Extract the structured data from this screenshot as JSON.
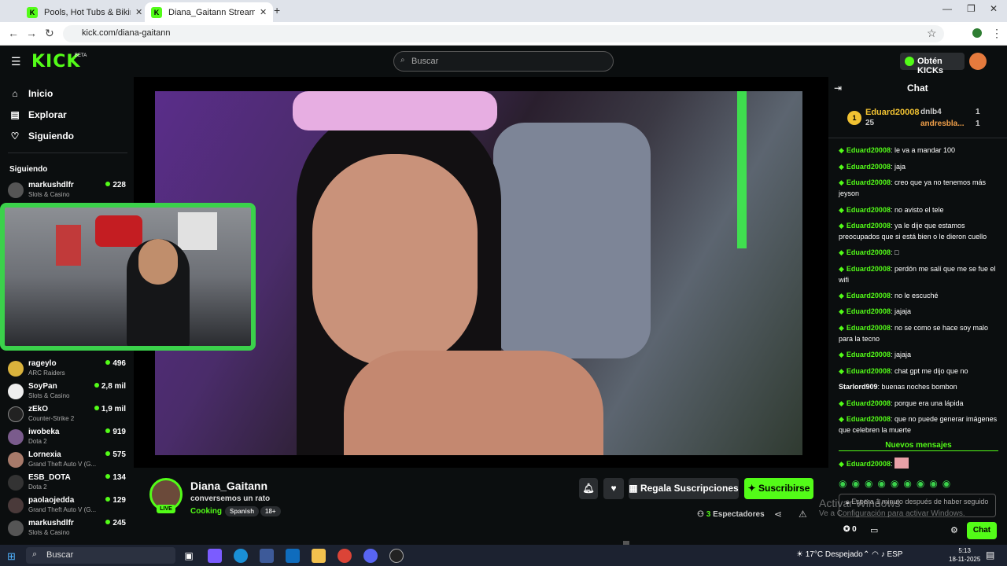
{
  "browser": {
    "tabs": [
      {
        "title": "Pools, Hot Tubs & Bikinis Strea"
      },
      {
        "title": "Diana_Gaitann Stream - Wa"
      }
    ],
    "url": "kick.com/diana-gaitann"
  },
  "header": {
    "logo": "KICK",
    "beta": "BETA",
    "search_placeholder": "Buscar",
    "kicks_label": "Obtén KICKs"
  },
  "sidebar": {
    "nav": [
      {
        "label": "Inicio"
      },
      {
        "label": "Explorar"
      },
      {
        "label": "Siguiendo"
      }
    ],
    "following_title": "Siguiendo",
    "channels": [
      {
        "name": "markushdlfr",
        "category": "Slots & Casino",
        "viewers": "228"
      },
      {
        "name": "rageylo",
        "category": "ARC Raiders",
        "viewers": "496"
      },
      {
        "name": "SoyPan",
        "category": "Slots & Casino",
        "viewers": "2,8 mil"
      },
      {
        "name": "zEkO",
        "category": "Counter-Strike 2",
        "viewers": "1,9 mil"
      },
      {
        "name": "iwobeka",
        "category": "Dota 2",
        "viewers": "919"
      },
      {
        "name": "Lornexia",
        "category": "Grand Theft Auto V (G...",
        "viewers": "575"
      },
      {
        "name": "ESB_DOTA",
        "category": "Dota 2",
        "viewers": "134"
      },
      {
        "name": "paolaojedda",
        "category": "Grand Theft Auto V (G...",
        "viewers": "129"
      },
      {
        "name": "markushdlfr",
        "category": "Slots & Casino",
        "viewers": "245"
      }
    ]
  },
  "stream": {
    "streamer": "Diana_Gaitann",
    "title": "conversemos un rato",
    "category": "Cooking",
    "tags": [
      "Spanish",
      "18+"
    ],
    "live": "LIVE",
    "gift_label": "Regala Suscripciones",
    "subscribe_label": "Suscribirse",
    "viewer_count": "3",
    "viewer_label": "Espectadores"
  },
  "chat": {
    "title": "Chat",
    "leaderboard": [
      {
        "name": "Eduard20008",
        "value": "25"
      },
      {
        "name": "dnlb4",
        "value": "1"
      },
      {
        "name": "andresbla...",
        "value": "1"
      }
    ],
    "rank": "1",
    "messages": [
      {
        "user": "Eduard20008",
        "text": "le va a mandar 100"
      },
      {
        "user": "Eduard20008",
        "text": "jaja"
      },
      {
        "user": "Eduard20008",
        "text": "creo que ya no tenemos más jeyson"
      },
      {
        "user": "Eduard20008",
        "text": "no avisto el tele"
      },
      {
        "user": "Eduard20008",
        "text": "ya le dije que estamos preocupados que si está bien o le dieron cuello"
      },
      {
        "user": "Eduard20008",
        "text": "□"
      },
      {
        "user": "Eduard20008",
        "text": "perdón me salí que me se fue el wifi"
      },
      {
        "user": "Eduard20008",
        "text": "no le escuché"
      },
      {
        "user": "Eduard20008",
        "text": "jajaja"
      },
      {
        "user": "Eduard20008",
        "text": "no se como se hace soy malo para la tecno"
      },
      {
        "user": "Eduard20008",
        "text": "jajaja"
      },
      {
        "user": "Eduard20008",
        "text": "chat gpt me dijo que no"
      },
      {
        "user": "Starlord909",
        "text": "buenas noches bombon"
      },
      {
        "user": "Eduard20008",
        "text": "porque era una lápida"
      },
      {
        "user": "Eduard20008",
        "text": "que no puede generar imágenes que celebren la muerte"
      }
    ],
    "new_messages": "Nuevos mensajes",
    "last_user": "Eduard20008",
    "input_text": "Espera 1 minuto después de haber seguido",
    "points": "0",
    "send_label": "Chat"
  },
  "watermark": {
    "line1": "Activar Windows",
    "line2": "Ve a Configuración para activar Windows."
  },
  "taskbar": {
    "search": "Buscar",
    "weather": "17°C  Despejado",
    "lang": "ESP",
    "time": "5:13",
    "date": "18-11-2025"
  }
}
